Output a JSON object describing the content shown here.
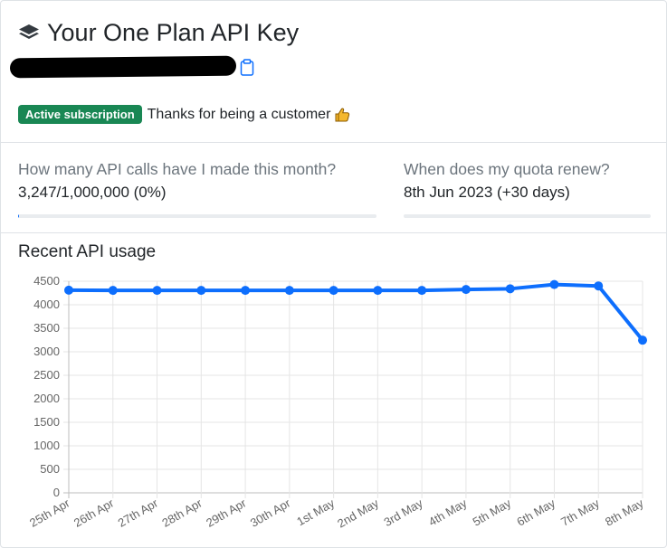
{
  "header": {
    "title": "Your One Plan API Key",
    "title_icon": "layers-icon",
    "api_key_masked": "••••••••••••••••••••••••••",
    "copy_icon": "clipboard-icon",
    "badge_label": "Active subscription",
    "badge_color": "#198754",
    "thanks_text": "Thanks for being a customer",
    "thanks_icon": "thumbs-up-icon"
  },
  "stats": {
    "calls_question": "How many API calls have I made this month?",
    "calls_value": "3,247/1,000,000 (0%)",
    "calls_progress": 0.003247,
    "renew_question": "When does my quota renew?",
    "renew_value": "8th Jun 2023 (+30 days)",
    "renew_progress": 0
  },
  "usage": {
    "title": "Recent API usage"
  },
  "chart_data": {
    "type": "line",
    "title": "Recent API usage",
    "xlabel": "",
    "ylabel": "",
    "categories": [
      "25th Apr",
      "26th Apr",
      "27th Apr",
      "28th Apr",
      "29th Apr",
      "30th Apr",
      "1st May",
      "2nd May",
      "3rd May",
      "4th May",
      "5th May",
      "6th May",
      "7th May",
      "8th May"
    ],
    "values": [
      4310,
      4305,
      4305,
      4305,
      4305,
      4305,
      4305,
      4305,
      4305,
      4325,
      4340,
      4430,
      4400,
      3247
    ],
    "ylim": [
      0,
      4500
    ],
    "yticks": [
      0,
      500,
      1000,
      1500,
      2000,
      2500,
      3000,
      3500,
      4000,
      4500
    ],
    "grid": true,
    "color": "#0d6efd"
  }
}
